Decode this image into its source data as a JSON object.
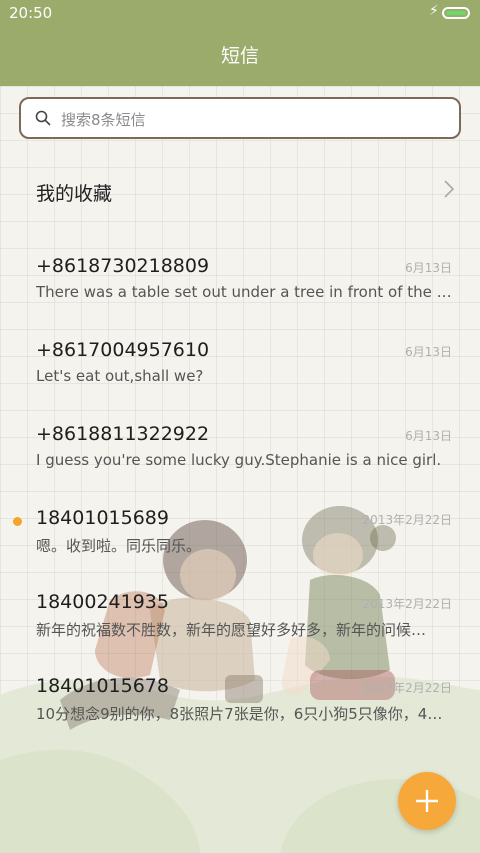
{
  "status_bar": {
    "time": "20:50"
  },
  "header": {
    "title": "短信"
  },
  "search": {
    "placeholder": "搜索8条短信"
  },
  "favorites": {
    "label": "我的收藏"
  },
  "messages": [
    {
      "sender": "+8618730218809",
      "date": "6月13日",
      "preview": "There was a table set out under a tree in front of the ho…",
      "unread": false
    },
    {
      "sender": "+8617004957610",
      "date": "6月13日",
      "preview": "Let's eat out,shall we?",
      "unread": false
    },
    {
      "sender": "+8618811322922",
      "date": "6月13日",
      "preview": "I guess you're some lucky guy.Stephanie is a nice girl.",
      "unread": false
    },
    {
      "sender": "18401015689",
      "date": "2013年2月22日",
      "preview": "嗯。收到啦。同乐同乐。",
      "unread": true
    },
    {
      "sender": "18400241935",
      "date": "2013年2月22日",
      "preview": "新年的祝福数不胜数，新年的愿望好多好多，新年的问候…",
      "unread": false
    },
    {
      "sender": "18401015678",
      "date": "2013年2月22日",
      "preview": "10分想念9别的你，8张照片7张是你，6只小狗5只像你，4…",
      "unread": false
    }
  ],
  "colors": {
    "header": "#9bab6b",
    "fab": "#f6a83a",
    "unread_dot": "#f4a42a"
  },
  "icons": {
    "search": "search-icon",
    "chevron": "chevron-right-icon",
    "fab": "plus-icon",
    "charging": "bolt-icon"
  }
}
